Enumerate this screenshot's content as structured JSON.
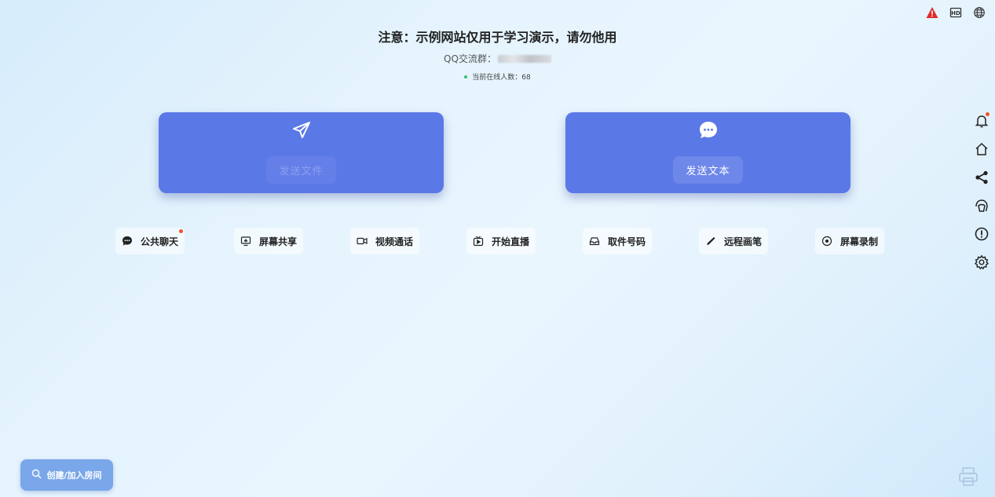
{
  "notice": {
    "title": "注意：示例网站仅用于学习演示，请勿他用",
    "qq_label": "QQ交流群：",
    "online_label": "当前在线人数：",
    "online_count": "68"
  },
  "top_icons": [
    "warning-icon",
    "hd-icon",
    "globe-icon"
  ],
  "cards": {
    "send_file": {
      "label": "发送文件",
      "icon": "paper-plane-icon"
    },
    "send_text": {
      "label": "发送文本",
      "icon": "chat-bubble-icon"
    }
  },
  "features": [
    {
      "label": "公共聊天",
      "icon": "chat-icon",
      "badge": true
    },
    {
      "label": "屏幕共享",
      "icon": "screen-share-icon"
    },
    {
      "label": "视频通话",
      "icon": "video-icon"
    },
    {
      "label": "开始直播",
      "icon": "live-tv-icon"
    },
    {
      "label": "取件号码",
      "icon": "inbox-icon"
    },
    {
      "label": "远程画笔",
      "icon": "pen-icon"
    },
    {
      "label": "屏幕录制",
      "icon": "record-icon"
    }
  ],
  "sidebar": [
    "bell-icon",
    "home-icon",
    "share-icon",
    "avatar-icon",
    "info-icon",
    "settings-icon"
  ],
  "room_button": {
    "label": "创建/加入房间",
    "icon": "search-icon"
  },
  "colors": {
    "card": "#5b78e7",
    "badge": "#f0542d",
    "online_dot": "#35c26d",
    "room_button": "#7aa7ea"
  }
}
